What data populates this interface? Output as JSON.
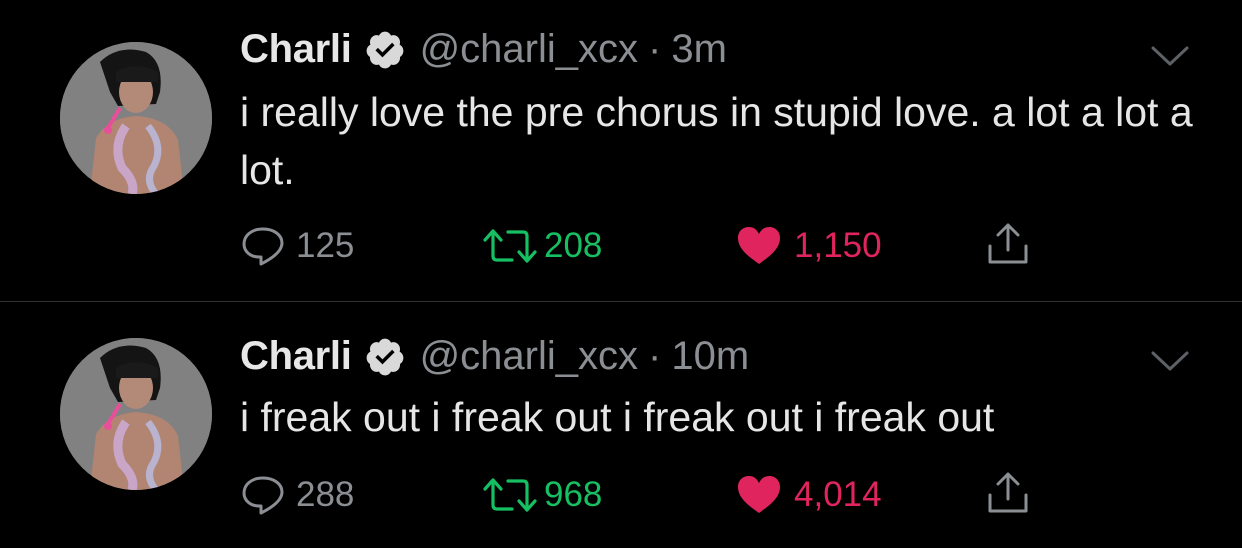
{
  "colors": {
    "background": "#000000",
    "name": "#e7e7e7",
    "muted": "#8b8f94",
    "retweet": "#17bf63",
    "like": "#e0245e",
    "verified_badge": "#d9d9d9",
    "divider": "#2f3336"
  },
  "tweets": [
    {
      "author": "Charli",
      "verified": true,
      "handle": "@charli_xcx",
      "separator": "·",
      "time": "3m",
      "text": "i really love the pre chorus in stupid love. a lot a lot a lot.",
      "replies": "125",
      "retweets": "208",
      "likes": "1,150",
      "liked": true,
      "icons": [
        "reply-icon",
        "retweet-icon",
        "heart-icon",
        "share-icon",
        "chevron-down-icon",
        "verified-badge-icon"
      ]
    },
    {
      "author": "Charli",
      "verified": true,
      "handle": "@charli_xcx",
      "separator": "·",
      "time": "10m",
      "text": "i freak out i freak out i freak out i freak out",
      "replies": "288",
      "retweets": "968",
      "likes": "4,014",
      "liked": true,
      "icons": [
        "reply-icon",
        "retweet-icon",
        "heart-icon",
        "share-icon",
        "chevron-down-icon",
        "verified-badge-icon"
      ]
    }
  ]
}
